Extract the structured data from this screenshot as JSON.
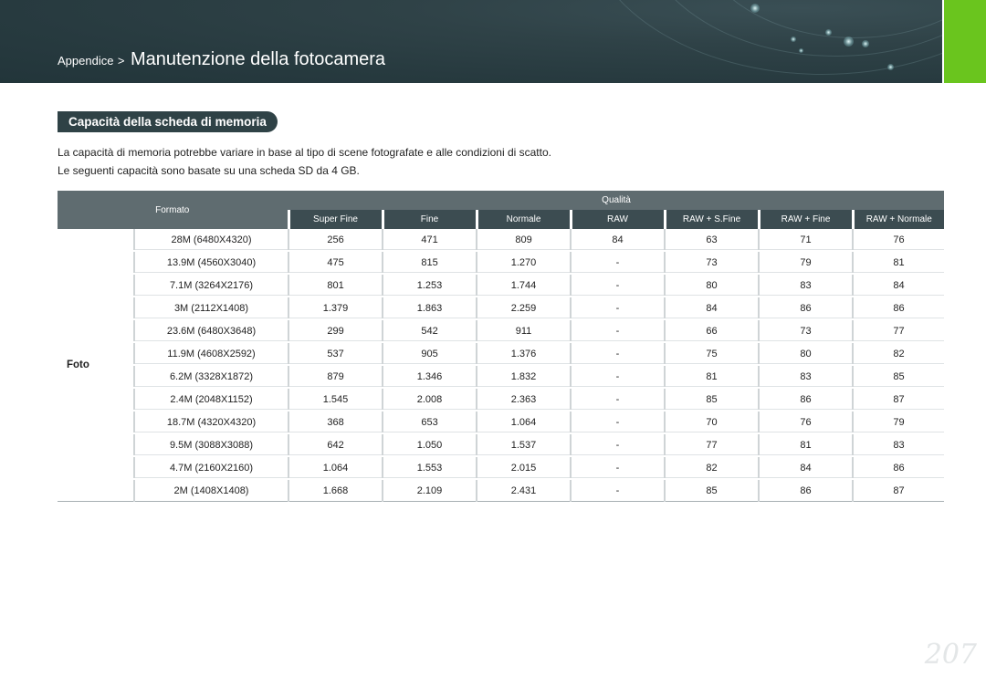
{
  "header": {
    "breadcrumb_parent": "Appendice",
    "breadcrumb_separator": ">",
    "title": "Manutenzione della fotocamera",
    "accent_color": "#6ac51e"
  },
  "section": {
    "title": "Capacità della scheda di memoria",
    "intro_line1": "La capacità di memoria potrebbe variare in base al tipo di scene fotografate e alle condizioni di scatto.",
    "intro_line2": "Le seguenti capacità sono basate su una scheda SD da 4 GB."
  },
  "table": {
    "col_formato": "Formato",
    "col_qualita": "Qualità",
    "quality_headers": [
      "Super Fine",
      "Fine",
      "Normale",
      "RAW",
      "RAW + S.Fine",
      "RAW + Fine",
      "RAW + Normale"
    ],
    "group_label": "Foto",
    "rows": [
      {
        "res": "28M (6480X4320)",
        "v": [
          "256",
          "471",
          "809",
          "84",
          "63",
          "71",
          "76"
        ]
      },
      {
        "res": "13.9M (4560X3040)",
        "v": [
          "475",
          "815",
          "1.270",
          "-",
          "73",
          "79",
          "81"
        ]
      },
      {
        "res": "7.1M (3264X2176)",
        "v": [
          "801",
          "1.253",
          "1.744",
          "-",
          "80",
          "83",
          "84"
        ]
      },
      {
        "res": "3M (2112X1408)",
        "v": [
          "1.379",
          "1.863",
          "2.259",
          "-",
          "84",
          "86",
          "86"
        ]
      },
      {
        "res": "23.6M (6480X3648)",
        "v": [
          "299",
          "542",
          "911",
          "-",
          "66",
          "73",
          "77"
        ]
      },
      {
        "res": "11.9M (4608X2592)",
        "v": [
          "537",
          "905",
          "1.376",
          "-",
          "75",
          "80",
          "82"
        ]
      },
      {
        "res": "6.2M (3328X1872)",
        "v": [
          "879",
          "1.346",
          "1.832",
          "-",
          "81",
          "83",
          "85"
        ]
      },
      {
        "res": "2.4M (2048X1152)",
        "v": [
          "1.545",
          "2.008",
          "2.363",
          "-",
          "85",
          "86",
          "87"
        ]
      },
      {
        "res": "18.7M (4320X4320)",
        "v": [
          "368",
          "653",
          "1.064",
          "-",
          "70",
          "76",
          "79"
        ]
      },
      {
        "res": "9.5M (3088X3088)",
        "v": [
          "642",
          "1.050",
          "1.537",
          "-",
          "77",
          "81",
          "83"
        ]
      },
      {
        "res": "4.7M (2160X2160)",
        "v": [
          "1.064",
          "1.553",
          "2.015",
          "-",
          "82",
          "84",
          "86"
        ]
      },
      {
        "res": "2M (1408X1408)",
        "v": [
          "1.668",
          "2.109",
          "2.431",
          "-",
          "85",
          "86",
          "87"
        ]
      }
    ]
  },
  "page_number": "207"
}
